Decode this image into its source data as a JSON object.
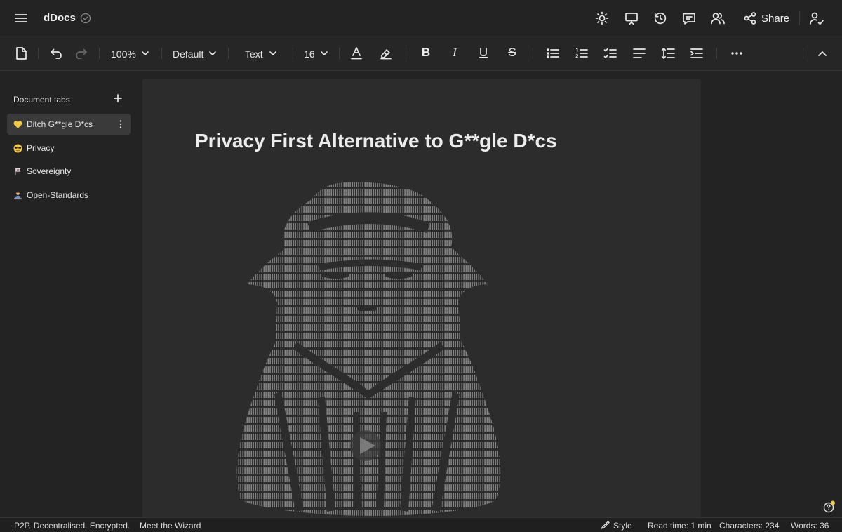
{
  "app": {
    "title": "dDocs"
  },
  "header": {
    "share_label": "Share"
  },
  "toolbar": {
    "zoom": "100%",
    "style": "Default",
    "block_type": "Text",
    "font_size": "16",
    "bold_glyph": "B",
    "italic_glyph": "I",
    "underline_glyph": "U",
    "strike_glyph": "S"
  },
  "sidebar": {
    "title": "Document tabs",
    "tabs": [
      {
        "label": "Ditch G**gle D*cs",
        "emoji": "yellow-heart",
        "active": true
      },
      {
        "label": "Privacy",
        "emoji": "sunglasses-face",
        "active": false
      },
      {
        "label": "Sovereignty",
        "emoji": "flag",
        "active": false
      },
      {
        "label": "Open-Standards",
        "emoji": "person-at-desk",
        "active": false
      }
    ]
  },
  "document": {
    "title": "Privacy First Alternative to G**gle D*cs",
    "media": "ascii-art-wizard-video"
  },
  "status": {
    "tagline": "P2P. Decentralised. Encrypted.",
    "wizard_link": "Meet the Wizard",
    "style_label": "Style",
    "read_time": "Read time: 1 min",
    "characters": "Characters: 234",
    "words": "Words: 36"
  },
  "colors": {
    "background": "#232323",
    "page": "#2c2c2c",
    "active_tab": "#3a3a3a",
    "notification_dot": "#f2c94c"
  }
}
